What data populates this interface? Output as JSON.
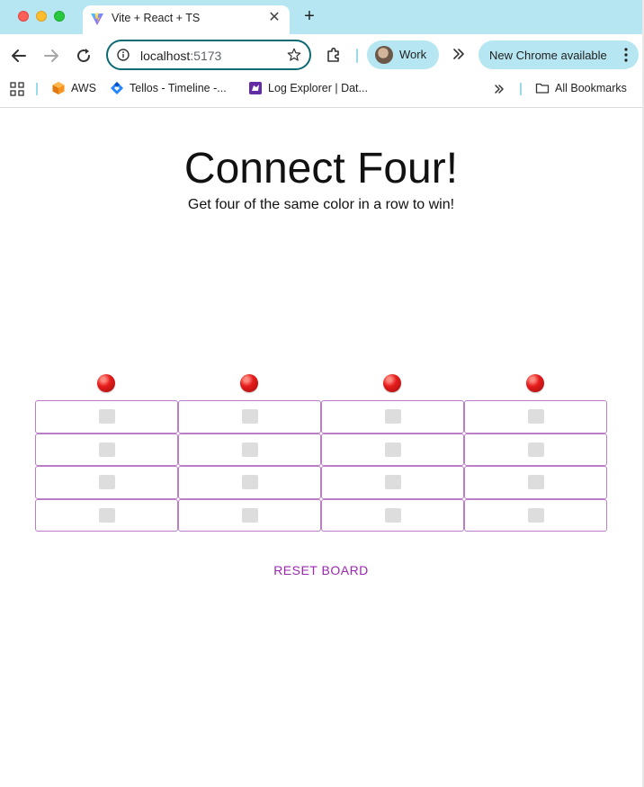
{
  "browser": {
    "tab": {
      "title": "Vite + React + TS",
      "favicon": "vite-icon",
      "close_glyph": "✕"
    },
    "new_tab_glyph": "+",
    "address_bar": {
      "host": "localhost",
      "port": ":5173"
    },
    "profile": {
      "label": "Work"
    },
    "update_notice": {
      "label": "New Chrome available"
    },
    "bookmarks": [
      {
        "label": "AWS",
        "icon": "aws-icon"
      },
      {
        "label": "Tellos - Timeline -...",
        "icon": "jira-icon"
      },
      {
        "label": "Log Explorer | Dat...",
        "icon": "datadog-icon"
      }
    ],
    "all_bookmarks_label": "All Bookmarks",
    "accent_color": "#b5e6f2"
  },
  "game": {
    "title": "Connect Four!",
    "subtitle": "Get four of the same color in a row to win!",
    "columns": 4,
    "rows": 4,
    "current_player_color": "red",
    "board": [
      [
        "empty",
        "empty",
        "empty",
        "empty"
      ],
      [
        "empty",
        "empty",
        "empty",
        "empty"
      ],
      [
        "empty",
        "empty",
        "empty",
        "empty"
      ],
      [
        "empty",
        "empty",
        "empty",
        "empty"
      ]
    ],
    "reset_label": "RESET BOARD",
    "colors": {
      "cell_border": "#b97ec6",
      "slot_empty": "#dddddd",
      "reset_text": "#9c27b0"
    }
  }
}
